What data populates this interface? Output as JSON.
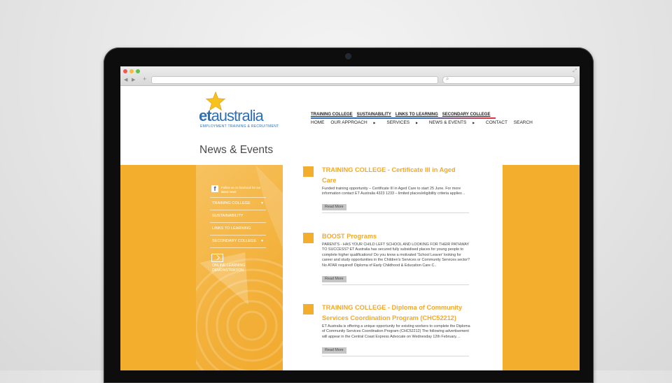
{
  "site": {
    "logo": {
      "et": "et",
      "australia": "australia",
      "tagline": "EMPLOYMENT TRAINING & RECRUITMENT"
    },
    "top_links": [
      "TRAINING COLLEGE",
      "SUSTAINABILITY",
      "LINKS TO LEARNING",
      "SECONDARY COLLEGE"
    ],
    "main_nav": [
      {
        "label": "HOME",
        "dropdown": false
      },
      {
        "label": "OUR APPROACH",
        "dropdown": true
      },
      {
        "label": "SERVICES",
        "dropdown": true
      },
      {
        "label": "NEWS & EVENTS",
        "dropdown": true
      },
      {
        "label": "CONTACT",
        "dropdown": false
      },
      {
        "label": "SEARCH",
        "dropdown": false
      }
    ],
    "page_title": "News & Events",
    "accent_color": "#f3ae2e",
    "brand_blue": "#2f6fb5"
  },
  "sidebar": {
    "facebook_icon": "f",
    "facebook_text": "Follow us on facebook for our latest news",
    "menu": [
      {
        "label": "TRAINING COLLEGE",
        "dropdown": true
      },
      {
        "label": "SUSTAINABILITY",
        "dropdown": false
      },
      {
        "label": "LINKS TO LEARNING",
        "dropdown": false
      },
      {
        "label": "SECONDARY COLLEGE",
        "dropdown": true
      }
    ],
    "online_learning": "ONLINE LEARNING DEMONSTRATION"
  },
  "news": [
    {
      "title": "TRAINING COLLEGE - Certificate III in Aged Care",
      "excerpt": "Funded training opportunity – Certificate III in Aged Care to start 25 June. For more information contact ET Australia 4323 1233 – limited places/eligibility criteria applies ..",
      "read_more": "Read More"
    },
    {
      "title": "BOOST Programs",
      "excerpt": "PARENTS - HAS YOUR CHILD LEFT SCHOOL AND LOOKING FOR THEIR PATHWAY TO SUCCESS? ET Australia has secured fully subsidised places for young people to complete higher qualifications! Do you know a motivated 'School Leaver' looking for career and study opportunities in the Children's Services or Community Services sector? No ATAR required! Diploma of Early Childhood & Education Care C..",
      "read_more": "Read More"
    },
    {
      "title": "TRAINING COLLEGE - Diploma of Community Services Coordination Program (CHC52212)",
      "excerpt": "ET Australia is offering a unique opportunity for existing workers to complete the Diploma of Community Services Coordination Program (CHC52212) The following advertisement will appear in the Central Coast Express Advocate on Wednesday 12th February. ..",
      "read_more": "Read More"
    }
  ],
  "browser": {
    "plus_glyph": "+",
    "back_glyph": "◀",
    "forward_glyph": "▶",
    "search_glyph": "⌕",
    "fullscreen_glyph": "⤢"
  }
}
